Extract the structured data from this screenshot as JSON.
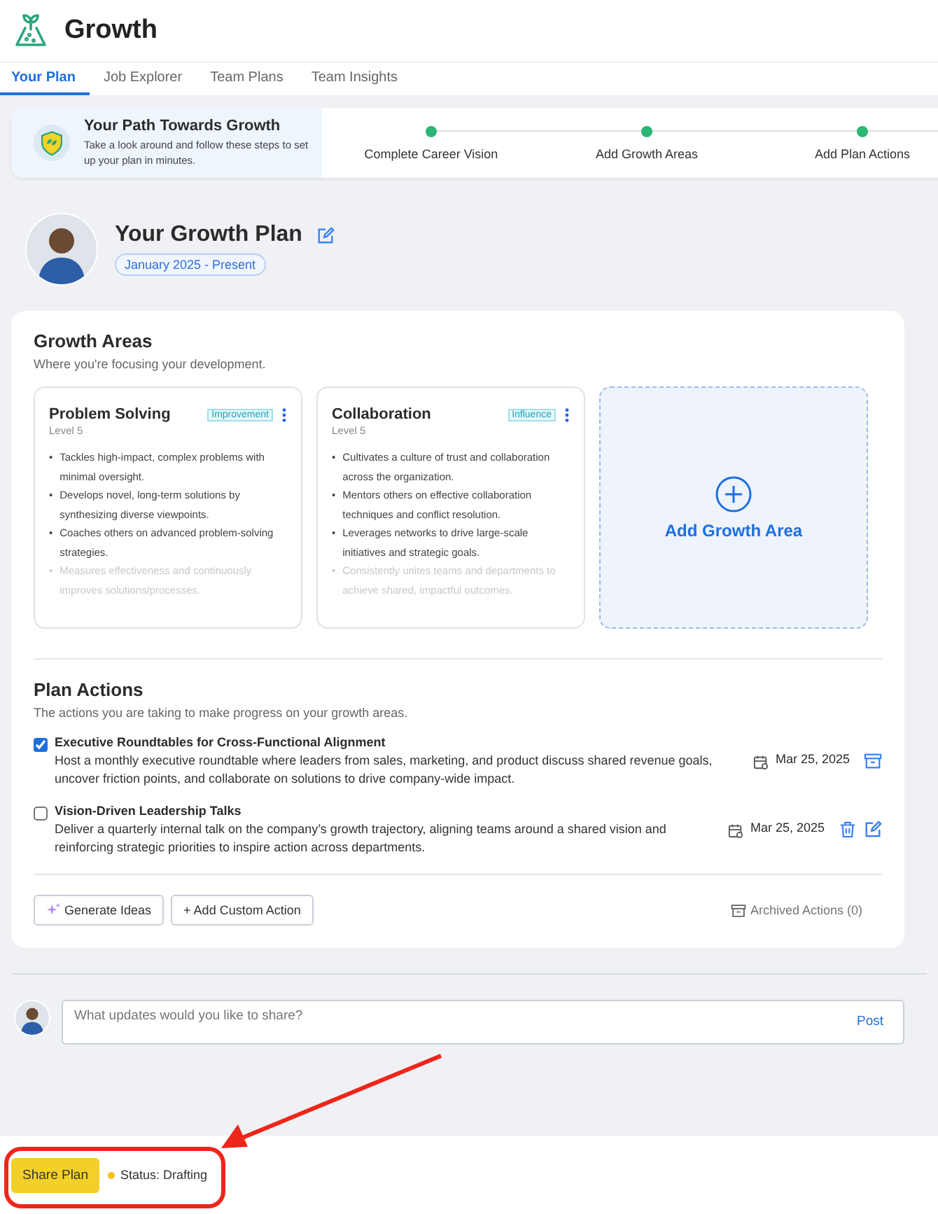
{
  "app": {
    "title": "Growth"
  },
  "tabs": [
    {
      "label": "Your Plan",
      "selected": true
    },
    {
      "label": "Job Explorer",
      "selected": false
    },
    {
      "label": "Team Plans",
      "selected": false
    },
    {
      "label": "Team Insights",
      "selected": false
    }
  ],
  "onboarding": {
    "title": "Your Path Towards Growth",
    "text": "Take a look around and follow these steps to set up your plan in minutes.",
    "steps": [
      {
        "label": "Complete Career Vision",
        "done": true
      },
      {
        "label": "Add Growth Areas",
        "done": true
      },
      {
        "label": "Add Plan Actions",
        "done": true
      }
    ]
  },
  "plan": {
    "title": "Your Growth Plan",
    "period": "January 2025 - Present"
  },
  "growth_areas": {
    "title": "Growth Areas",
    "subtitle": "Where you're focusing your development.",
    "cards": [
      {
        "title": "Problem Solving",
        "level": "Level 5",
        "tag": "Improvement",
        "bullets": [
          {
            "marker": "•",
            "text": "Tackles high-impact, complex problems with minimal oversight.",
            "faded": false
          },
          {
            "marker": "•",
            "text": "Develops novel, long-term solutions by synthesizing diverse viewpoints.",
            "faded": false
          },
          {
            "marker": "•",
            "text": "Coaches others on advanced problem-solving strategies.",
            "faded": false
          },
          {
            "marker": "•",
            "text": "Measures effectiveness and continuously improves solutions/processes.",
            "faded": true
          }
        ]
      },
      {
        "title": "Collaboration",
        "level": "Level 5",
        "tag": "Influence",
        "bullets": [
          {
            "marker": "•",
            "text": "Cultivates a culture of trust and collaboration across the organization.",
            "faded": false
          },
          {
            "marker": "•",
            "text": "Mentors others on effective collaboration techniques and conflict resolution.",
            "faded": false
          },
          {
            "marker": "•",
            "text": "Leverages networks to drive large-scale initiatives and strategic goals.",
            "faded": false
          },
          {
            "marker": "•",
            "text": "Consistently unites teams and departments to achieve shared, impactful outcomes.",
            "faded": true
          }
        ]
      }
    ],
    "add_label": "Add Growth Area"
  },
  "plan_actions": {
    "title": "Plan Actions",
    "subtitle": "The actions you are taking to make progress on your growth areas.",
    "items": [
      {
        "title": "Executive Roundtables for Cross-Functional Alignment",
        "checked": true,
        "text": "Host a monthly executive roundtable where leaders from sales, marketing, and product discuss shared revenue goals, uncover friction points, and collaborate on solutions to drive company-wide impact.",
        "date": "Mar 25, 2025",
        "icons": [
          {
            "kind": "archive"
          }
        ]
      },
      {
        "title": "Vision-Driven Leadership Talks",
        "checked": false,
        "text": "Deliver a quarterly internal talk on the company’s growth trajectory, aligning teams around a shared vision and reinforcing strategic priorities to inspire action across departments.",
        "date": "Mar 25, 2025",
        "icons": [
          {
            "kind": "trash"
          },
          {
            "kind": "edit"
          }
        ]
      }
    ],
    "buttons": [
      "Generate Ideas",
      "+ Add Custom Action"
    ],
    "archived": "Archived Actions (0)"
  },
  "update": {
    "placeholder": "What updates would you like to share?",
    "post": "Post"
  },
  "footer": {
    "button": "Share Plan",
    "status": "Status: Drafting"
  }
}
